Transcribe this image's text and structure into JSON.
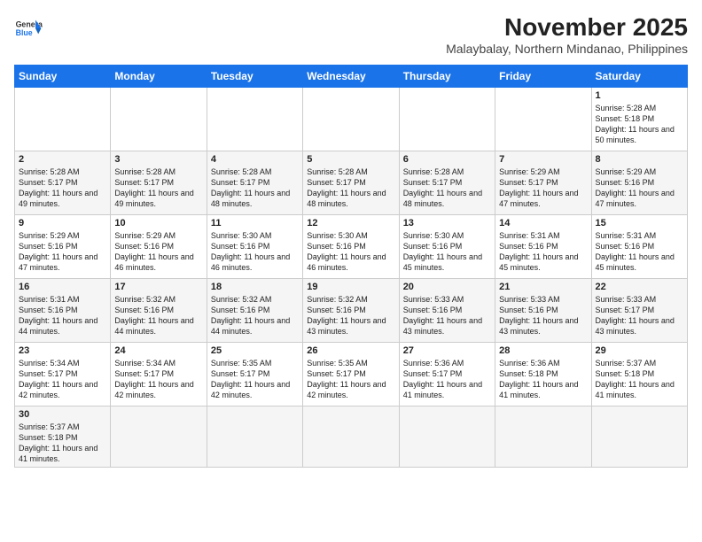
{
  "header": {
    "logo_general": "General",
    "logo_blue": "Blue",
    "title": "November 2025",
    "subtitle": "Malaybalay, Northern Mindanao, Philippines"
  },
  "weekdays": [
    "Sunday",
    "Monday",
    "Tuesday",
    "Wednesday",
    "Thursday",
    "Friday",
    "Saturday"
  ],
  "weeks": [
    [
      {
        "day": "",
        "sunrise": "",
        "sunset": "",
        "daylight": ""
      },
      {
        "day": "",
        "sunrise": "",
        "sunset": "",
        "daylight": ""
      },
      {
        "day": "",
        "sunrise": "",
        "sunset": "",
        "daylight": ""
      },
      {
        "day": "",
        "sunrise": "",
        "sunset": "",
        "daylight": ""
      },
      {
        "day": "",
        "sunrise": "",
        "sunset": "",
        "daylight": ""
      },
      {
        "day": "",
        "sunrise": "",
        "sunset": "",
        "daylight": ""
      },
      {
        "day": "1",
        "sunrise": "Sunrise: 5:28 AM",
        "sunset": "Sunset: 5:18 PM",
        "daylight": "Daylight: 11 hours and 50 minutes."
      }
    ],
    [
      {
        "day": "2",
        "sunrise": "Sunrise: 5:28 AM",
        "sunset": "Sunset: 5:17 PM",
        "daylight": "Daylight: 11 hours and 49 minutes."
      },
      {
        "day": "3",
        "sunrise": "Sunrise: 5:28 AM",
        "sunset": "Sunset: 5:17 PM",
        "daylight": "Daylight: 11 hours and 49 minutes."
      },
      {
        "day": "4",
        "sunrise": "Sunrise: 5:28 AM",
        "sunset": "Sunset: 5:17 PM",
        "daylight": "Daylight: 11 hours and 48 minutes."
      },
      {
        "day": "5",
        "sunrise": "Sunrise: 5:28 AM",
        "sunset": "Sunset: 5:17 PM",
        "daylight": "Daylight: 11 hours and 48 minutes."
      },
      {
        "day": "6",
        "sunrise": "Sunrise: 5:28 AM",
        "sunset": "Sunset: 5:17 PM",
        "daylight": "Daylight: 11 hours and 48 minutes."
      },
      {
        "day": "7",
        "sunrise": "Sunrise: 5:29 AM",
        "sunset": "Sunset: 5:17 PM",
        "daylight": "Daylight: 11 hours and 47 minutes."
      },
      {
        "day": "8",
        "sunrise": "Sunrise: 5:29 AM",
        "sunset": "Sunset: 5:16 PM",
        "daylight": "Daylight: 11 hours and 47 minutes."
      }
    ],
    [
      {
        "day": "9",
        "sunrise": "Sunrise: 5:29 AM",
        "sunset": "Sunset: 5:16 PM",
        "daylight": "Daylight: 11 hours and 47 minutes."
      },
      {
        "day": "10",
        "sunrise": "Sunrise: 5:29 AM",
        "sunset": "Sunset: 5:16 PM",
        "daylight": "Daylight: 11 hours and 46 minutes."
      },
      {
        "day": "11",
        "sunrise": "Sunrise: 5:30 AM",
        "sunset": "Sunset: 5:16 PM",
        "daylight": "Daylight: 11 hours and 46 minutes."
      },
      {
        "day": "12",
        "sunrise": "Sunrise: 5:30 AM",
        "sunset": "Sunset: 5:16 PM",
        "daylight": "Daylight: 11 hours and 46 minutes."
      },
      {
        "day": "13",
        "sunrise": "Sunrise: 5:30 AM",
        "sunset": "Sunset: 5:16 PM",
        "daylight": "Daylight: 11 hours and 45 minutes."
      },
      {
        "day": "14",
        "sunrise": "Sunrise: 5:31 AM",
        "sunset": "Sunset: 5:16 PM",
        "daylight": "Daylight: 11 hours and 45 minutes."
      },
      {
        "day": "15",
        "sunrise": "Sunrise: 5:31 AM",
        "sunset": "Sunset: 5:16 PM",
        "daylight": "Daylight: 11 hours and 45 minutes."
      }
    ],
    [
      {
        "day": "16",
        "sunrise": "Sunrise: 5:31 AM",
        "sunset": "Sunset: 5:16 PM",
        "daylight": "Daylight: 11 hours and 44 minutes."
      },
      {
        "day": "17",
        "sunrise": "Sunrise: 5:32 AM",
        "sunset": "Sunset: 5:16 PM",
        "daylight": "Daylight: 11 hours and 44 minutes."
      },
      {
        "day": "18",
        "sunrise": "Sunrise: 5:32 AM",
        "sunset": "Sunset: 5:16 PM",
        "daylight": "Daylight: 11 hours and 44 minutes."
      },
      {
        "day": "19",
        "sunrise": "Sunrise: 5:32 AM",
        "sunset": "Sunset: 5:16 PM",
        "daylight": "Daylight: 11 hours and 43 minutes."
      },
      {
        "day": "20",
        "sunrise": "Sunrise: 5:33 AM",
        "sunset": "Sunset: 5:16 PM",
        "daylight": "Daylight: 11 hours and 43 minutes."
      },
      {
        "day": "21",
        "sunrise": "Sunrise: 5:33 AM",
        "sunset": "Sunset: 5:16 PM",
        "daylight": "Daylight: 11 hours and 43 minutes."
      },
      {
        "day": "22",
        "sunrise": "Sunrise: 5:33 AM",
        "sunset": "Sunset: 5:17 PM",
        "daylight": "Daylight: 11 hours and 43 minutes."
      }
    ],
    [
      {
        "day": "23",
        "sunrise": "Sunrise: 5:34 AM",
        "sunset": "Sunset: 5:17 PM",
        "daylight": "Daylight: 11 hours and 42 minutes."
      },
      {
        "day": "24",
        "sunrise": "Sunrise: 5:34 AM",
        "sunset": "Sunset: 5:17 PM",
        "daylight": "Daylight: 11 hours and 42 minutes."
      },
      {
        "day": "25",
        "sunrise": "Sunrise: 5:35 AM",
        "sunset": "Sunset: 5:17 PM",
        "daylight": "Daylight: 11 hours and 42 minutes."
      },
      {
        "day": "26",
        "sunrise": "Sunrise: 5:35 AM",
        "sunset": "Sunset: 5:17 PM",
        "daylight": "Daylight: 11 hours and 42 minutes."
      },
      {
        "day": "27",
        "sunrise": "Sunrise: 5:36 AM",
        "sunset": "Sunset: 5:17 PM",
        "daylight": "Daylight: 11 hours and 41 minutes."
      },
      {
        "day": "28",
        "sunrise": "Sunrise: 5:36 AM",
        "sunset": "Sunset: 5:18 PM",
        "daylight": "Daylight: 11 hours and 41 minutes."
      },
      {
        "day": "29",
        "sunrise": "Sunrise: 5:37 AM",
        "sunset": "Sunset: 5:18 PM",
        "daylight": "Daylight: 11 hours and 41 minutes."
      }
    ],
    [
      {
        "day": "30",
        "sunrise": "Sunrise: 5:37 AM",
        "sunset": "Sunset: 5:18 PM",
        "daylight": "Daylight: 11 hours and 41 minutes."
      },
      {
        "day": "",
        "sunrise": "",
        "sunset": "",
        "daylight": ""
      },
      {
        "day": "",
        "sunrise": "",
        "sunset": "",
        "daylight": ""
      },
      {
        "day": "",
        "sunrise": "",
        "sunset": "",
        "daylight": ""
      },
      {
        "day": "",
        "sunrise": "",
        "sunset": "",
        "daylight": ""
      },
      {
        "day": "",
        "sunrise": "",
        "sunset": "",
        "daylight": ""
      },
      {
        "day": "",
        "sunrise": "",
        "sunset": "",
        "daylight": ""
      }
    ]
  ]
}
